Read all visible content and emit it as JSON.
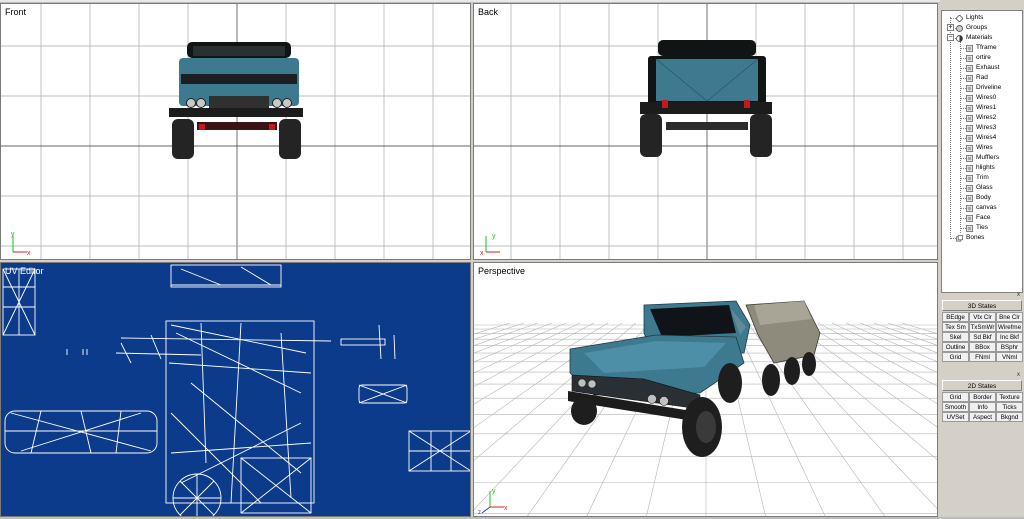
{
  "viewports": {
    "front": {
      "label": "Front"
    },
    "back": {
      "label": "Back"
    },
    "uv": {
      "label": "UV Editor"
    },
    "perspective": {
      "label": "Perspective"
    }
  },
  "axis": {
    "y": "y",
    "x": "x",
    "z": "z"
  },
  "colors": {
    "truck_body": "#3d7a90",
    "uv_background": "#0c3b8c",
    "grid_line": "#a8a8a8",
    "axis_y": "#17c317",
    "axis_x": "#d41c1c"
  },
  "tree": {
    "items": [
      {
        "label": "Lights",
        "icon": "light-icon"
      },
      {
        "label": "Groups",
        "icon": "groups-icon"
      },
      {
        "label": "Materials",
        "icon": "materials-icon"
      },
      {
        "label": "Tframe",
        "icon": "material-icon"
      },
      {
        "label": "ortire",
        "icon": "material-icon"
      },
      {
        "label": "Exhaust",
        "icon": "material-icon"
      },
      {
        "label": "Rad",
        "icon": "material-icon"
      },
      {
        "label": "Driveline",
        "icon": "material-icon"
      },
      {
        "label": "Wires0",
        "icon": "material-icon"
      },
      {
        "label": "Wires1",
        "icon": "material-icon"
      },
      {
        "label": "Wires2",
        "icon": "material-icon"
      },
      {
        "label": "Wires3",
        "icon": "material-icon"
      },
      {
        "label": "Wires4",
        "icon": "material-icon"
      },
      {
        "label": "Wires",
        "icon": "material-icon"
      },
      {
        "label": "Mufflers",
        "icon": "material-icon"
      },
      {
        "label": "hlights",
        "icon": "material-icon"
      },
      {
        "label": "Trim",
        "icon": "material-icon"
      },
      {
        "label": "Glass",
        "icon": "material-icon"
      },
      {
        "label": "Body",
        "icon": "material-icon"
      },
      {
        "label": "canvas",
        "icon": "material-icon"
      },
      {
        "label": "Face",
        "icon": "material-icon"
      },
      {
        "label": "Ties",
        "icon": "material-icon"
      },
      {
        "label": "Bones",
        "icon": "bones-icon"
      }
    ]
  },
  "states3d": {
    "title": "3D States",
    "close": "x",
    "buttons": [
      "BEdge",
      "Vtx Clr",
      "Bne Clr",
      "Tex Sm",
      "TxSmWr",
      "Wirefme",
      "Skel",
      "Sd Bkf",
      "Inc Bkf",
      "Outline",
      "BBox",
      "BSphr",
      "Grid",
      "FNml",
      "VNml"
    ]
  },
  "states2d": {
    "title": "2D States",
    "close": "x",
    "buttons": [
      "Grid",
      "Border",
      "Texture",
      "Smooth",
      "Info",
      "Ticks",
      "UVSet",
      "Aspect",
      "Bkgnd"
    ]
  }
}
